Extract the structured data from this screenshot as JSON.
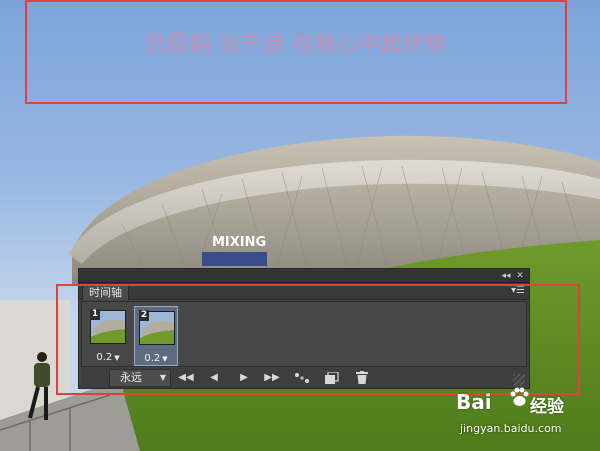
{
  "caption": {
    "text": "仍愿翻 百千浪 在我心中起伏够"
  },
  "photo": {
    "stadium_sign": "MIXING"
  },
  "timeline_panel": {
    "title_buttons": [
      "◂◂",
      "✕"
    ],
    "tab_label": "时间轴",
    "menu_icon": "panel-menu-icon",
    "frames": [
      {
        "number": "1",
        "delay": "0.2",
        "selected": false
      },
      {
        "number": "2",
        "delay": "0.2",
        "selected": true
      }
    ],
    "loop_option": "永远",
    "controls": {
      "first_frame": "◀◀",
      "prev_frame": "◀",
      "play": "▶",
      "next_frame": "▶▶"
    }
  },
  "watermark": {
    "brand": "Bai",
    "brand_suffix": "经验",
    "url": "jingyan.baidu.com"
  },
  "colors": {
    "annotation_red": "#e0413f",
    "caption_pink": "#c98fb3",
    "panel_bg": "#434343",
    "selected_frame": "#5d6b80"
  }
}
